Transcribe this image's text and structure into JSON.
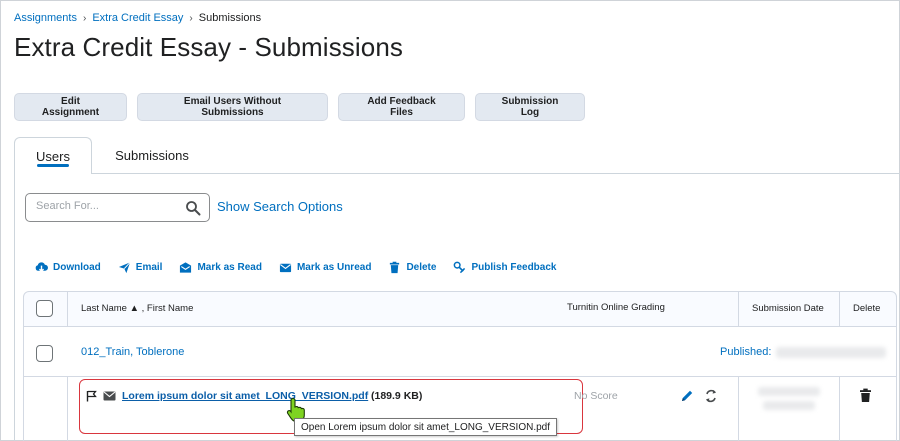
{
  "breadcrumb": {
    "items": [
      "Assignments",
      "Extra Credit Essay"
    ],
    "current": "Submissions"
  },
  "page": {
    "title": "Extra Credit Essay - Submissions"
  },
  "buttons": {
    "edit_assignment": "Edit Assignment",
    "email_users": "Email Users Without Submissions",
    "add_feedback": "Add Feedback Files",
    "submission_log": "Submission Log"
  },
  "tabs": [
    {
      "label": "Users",
      "active": true
    },
    {
      "label": "Submissions",
      "active": false
    }
  ],
  "search": {
    "placeholder": "Search For...",
    "value": "",
    "options_link": "Show Search Options"
  },
  "actions": [
    {
      "label": "Download",
      "icon": "download-icon"
    },
    {
      "label": "Email",
      "icon": "send-icon"
    },
    {
      "label": "Mark as Read",
      "icon": "mark-read-icon"
    },
    {
      "label": "Mark as Unread",
      "icon": "envelope-icon"
    },
    {
      "label": "Delete",
      "icon": "trash-icon"
    },
    {
      "label": "Publish Feedback",
      "icon": "publish-icon"
    }
  ],
  "table": {
    "columns": {
      "name": "Last Name",
      "name_sort": "▲",
      "name_secondary": ", First Name",
      "turnitin": "Turnitin Online Grading",
      "submission_date": "Submission Date",
      "delete": "Delete"
    },
    "group": {
      "name": "012_Train, Toblerone",
      "status": "Published:"
    },
    "submission": {
      "file_name": "Lorem ipsum dolor sit amet_LONG_VERSION.pdf",
      "file_size": "(189.9 KB)",
      "score": "No Score",
      "tooltip": "Open Lorem ipsum dolor sit amet_LONG_VERSION.pdf"
    }
  },
  "colors": {
    "link": "#006fbf",
    "button_bg": "#e3e9f1",
    "highlight": "#d9363e"
  }
}
